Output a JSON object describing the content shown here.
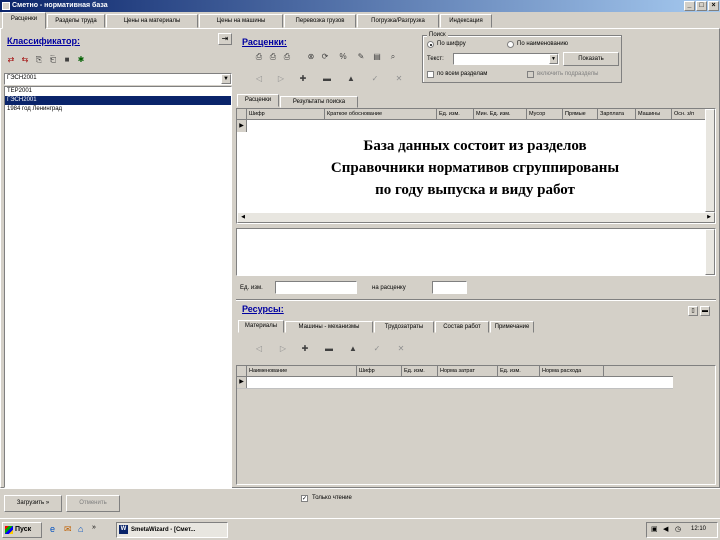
{
  "window": {
    "title": "Сметно - нормативная база"
  },
  "tabs": [
    {
      "label": "Расценки",
      "active": true
    },
    {
      "label": "Разделы труда"
    },
    {
      "label": "Цены на материалы"
    },
    {
      "label": "Цены на машины"
    },
    {
      "label": "Перевозка грузов"
    },
    {
      "label": "Погрузка/Разгрузка"
    },
    {
      "label": "Индексация"
    }
  ],
  "classifier": {
    "title": "Классификатор:",
    "dropdown_value": "ГЭСН2001",
    "tree_items": [
      {
        "label": "ТЕР2001",
        "selected": false
      },
      {
        "label": "ГЭСН2001",
        "selected": true
      },
      {
        "label": "1984 год Ленинград",
        "selected": false
      }
    ]
  },
  "rates": {
    "title": "Расценки:",
    "search": {
      "group_label": "Поиск",
      "radio_code": "По шифру",
      "radio_name": "По наименованию",
      "text_label": "Текст:",
      "text_value": "",
      "show_button": "Показать",
      "check_all_sections": "по всем разделам",
      "check_other": "включить подразделы"
    },
    "subtabs": [
      "Расценки",
      "Результаты поиска"
    ],
    "columns": [
      "Шифр",
      "Краткое обоснование",
      "Ед. изм.",
      "Мин. Ед. изм.",
      "Мусор",
      "Прямые",
      "Зарплата",
      "Машины",
      "Осн. з/п"
    ],
    "overlay_lines": [
      "База данных состоит из разделов",
      "Справочники нормативов сгруппированы",
      "по году выпуска и виду работ"
    ],
    "unit_label": "Ед. изм.",
    "unit_value": "",
    "per_rate_label": "на расценку",
    "per_rate_value": ""
  },
  "resources": {
    "title": "Ресурсы:",
    "subtabs": [
      "Материалы",
      "Машины - механизмы",
      "Трудозатраты",
      "Состав работ",
      "Примечание"
    ],
    "columns": [
      "Наименование",
      "Шифр",
      "Ед. изм.",
      "Норма затрат",
      "Ед. изм.",
      "Норма расхода"
    ]
  },
  "bottom": {
    "next_button": "Загрузить",
    "cancel_button": "Отменить",
    "check_label": "Только чтение",
    "check_checked": true
  },
  "taskbar": {
    "start_label": "Пуск",
    "app_label": "SmetaWizard - [Смет...",
    "time": "12:10"
  }
}
